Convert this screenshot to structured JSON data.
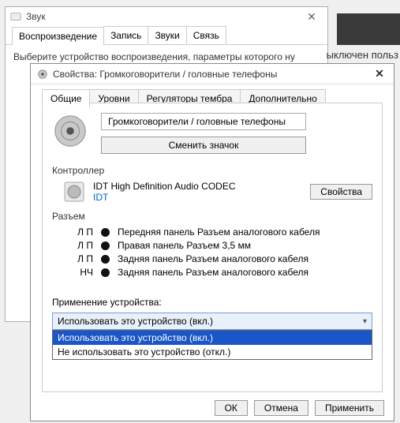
{
  "background_window": {
    "title": "Звук",
    "tabs": [
      "Воспроизведение",
      "Запись",
      "Звуки",
      "Связь"
    ],
    "instruction": "Выберите устройство воспроизведения, параметры которого ну"
  },
  "bg_partial_text": "ыключен  польз",
  "properties_window": {
    "title": "Свойства: Громкоговорители / головные телефоны",
    "tabs": {
      "general": "Общие",
      "levels": "Уровни",
      "enhancements": "Регуляторы тембра",
      "advanced": "Дополнительно"
    },
    "device_name": "Громкоговорители / головные телефоны",
    "change_icon": "Сменить значок",
    "controller_label": "Контроллер",
    "controller": {
      "name": "IDT High Definition Audio CODEC",
      "link": "IDT",
      "properties_btn": "Свойства"
    },
    "jack_label": "Разъем",
    "jacks": [
      {
        "ch": "Л П",
        "desc": "Передняя панель Разъем аналогового кабеля"
      },
      {
        "ch": "Л П",
        "desc": "Правая панель Разъем 3,5 мм"
      },
      {
        "ch": "Л П",
        "desc": "Задняя панель Разъем аналогового кабеля"
      },
      {
        "ch": "НЧ",
        "desc": "Задняя панель Разъем аналогового кабеля"
      }
    ],
    "usage_label": "Применение устройства:",
    "usage_selected": "Использовать это устройство (вкл.)",
    "usage_options": [
      "Использовать это устройство (вкл.)",
      "Не использовать это устройство (откл.)"
    ],
    "buttons": {
      "ok": "ОК",
      "cancel": "Отмена",
      "apply": "Применить"
    }
  }
}
